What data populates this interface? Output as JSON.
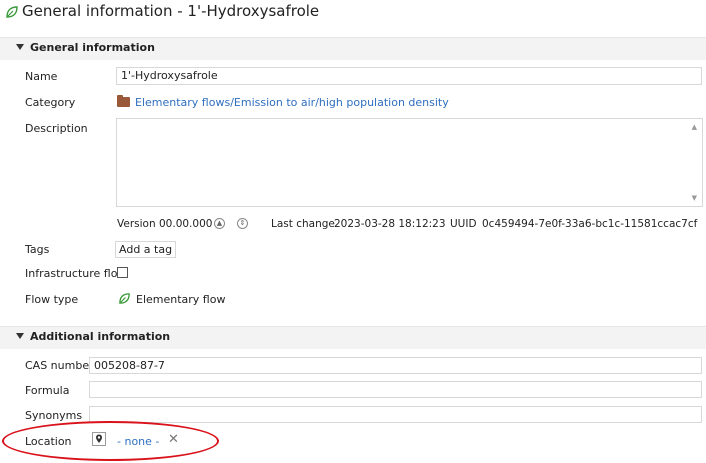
{
  "header": {
    "title": "General information - 1'-Hydroxysafrole"
  },
  "general_section": {
    "title": "General information",
    "name_label": "Name",
    "name_value": "1'-Hydroxysafrole",
    "category_label": "Category",
    "category_value": "Elementary flows/Emission to air/high population density",
    "description_label": "Description",
    "description_value": "",
    "version_label": "Version",
    "version_value": "00.00.000",
    "last_change_label": "Last change",
    "last_change_value": "2023-03-28 18:12:23",
    "uuid_label": "UUID",
    "uuid_value": "0c459494-7e0f-33a6-bc1c-11581ccac7cf",
    "tags_label": "Tags",
    "add_tag_label": "Add a tag",
    "infrastructure_label": "Infrastructure flow",
    "infrastructure_checked": false,
    "flow_type_label": "Flow type",
    "flow_type_value": "Elementary flow"
  },
  "additional_section": {
    "title": "Additional information",
    "cas_label": "CAS number",
    "cas_value": "005208-87-7",
    "formula_label": "Formula",
    "formula_value": "",
    "synonyms_label": "Synonyms",
    "synonyms_value": "",
    "location_label": "Location",
    "location_value": "- none -"
  },
  "icons": {
    "title": "leaf-icon",
    "category": "folder-icon",
    "flow_type": "leaf-icon",
    "location": "map-pin-icon",
    "clear": "close-icon"
  },
  "colors": {
    "link": "#2f6fbf",
    "folder": "#9a5a3a",
    "leaf": "#3a9a3a",
    "highlight": "#d9121b"
  }
}
